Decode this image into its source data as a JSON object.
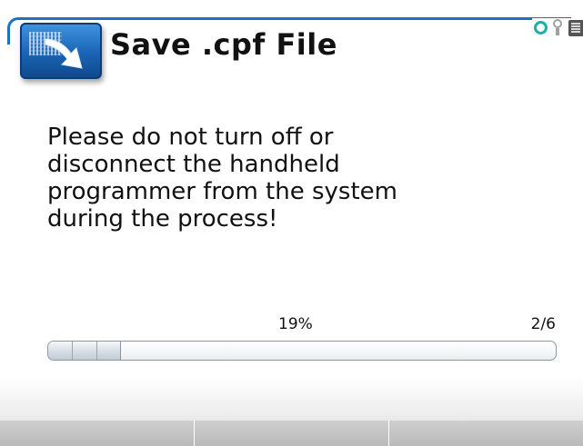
{
  "window": {
    "title": "Save .cpf File"
  },
  "status_bar": {
    "icons": [
      "connection-ring-icon",
      "key-icon",
      "battery-icon"
    ],
    "accent_color": "#16b4a6"
  },
  "message": {
    "lines": [
      "Please do not turn off or",
      "disconnect the handheld",
      "programmer from the system",
      "during the process!"
    ]
  },
  "progress": {
    "percent_label": "19%",
    "percent_value": 19,
    "step_label": "2/6",
    "filled_segments": 3
  },
  "softkeys": [
    {
      "label": ""
    },
    {
      "label": ""
    },
    {
      "label": ""
    }
  ],
  "colors": {
    "frame_blue": "#1c72c4",
    "icon_blue": "#1a64b4"
  }
}
